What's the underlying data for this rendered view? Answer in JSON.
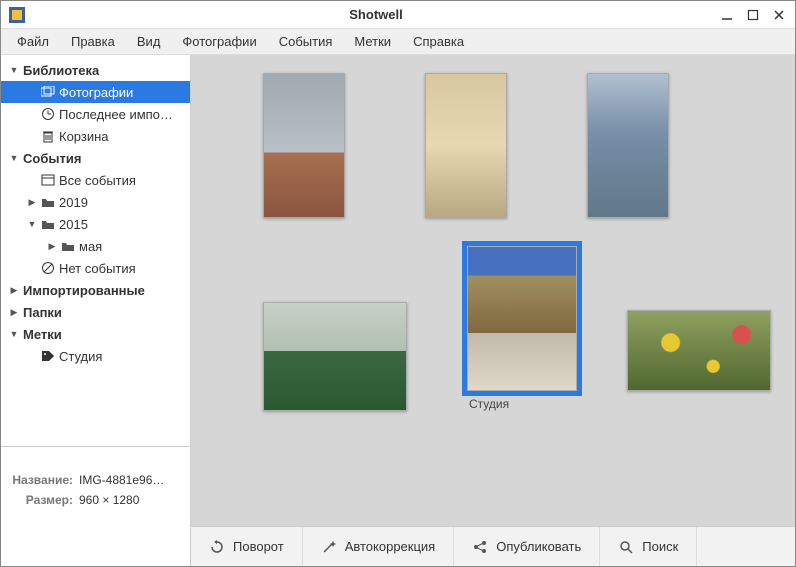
{
  "title": "Shotwell",
  "menu": [
    "Файл",
    "Правка",
    "Вид",
    "Фотографии",
    "События",
    "Метки",
    "Справка"
  ],
  "sidebar": {
    "library": {
      "label": "Библиотека",
      "photos": "Фотографии",
      "last_import": "Последнее импо…",
      "trash": "Корзина"
    },
    "events": {
      "label": "События",
      "all": "Все события",
      "y2019": "2019",
      "y2015": "2015",
      "may": "мая",
      "no_event": "Нет события"
    },
    "imported": "Импортированные",
    "folders": "Папки",
    "tags": {
      "label": "Метки",
      "studio": "Студия"
    }
  },
  "info": {
    "name_label": "Название:",
    "name_value": "IMG-4881e96…",
    "size_label": "Размер:",
    "size_value": "960 × 1280"
  },
  "thumbs": {
    "t5_caption": "Студия"
  },
  "toolbar": {
    "rotate": "Поворот",
    "enhance": "Автокоррекция",
    "publish": "Опубликовать",
    "find": "Поиск"
  }
}
